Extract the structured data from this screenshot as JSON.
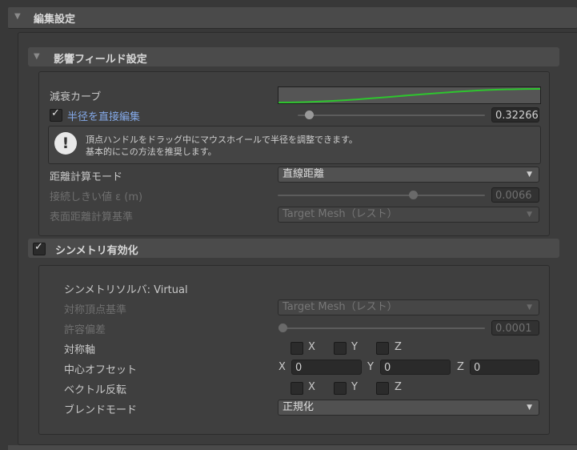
{
  "header": {
    "title": "編集設定"
  },
  "influence": {
    "title": "影響フィールド設定",
    "falloff_curve_label": "減衰カーブ",
    "falloff_curve_color": "#2ec52e",
    "direct_radius_label": "半径を直接編集",
    "direct_radius_checked": true,
    "radius_value": "0.32266",
    "radius_level": 0.04,
    "help_line1": "頂点ハンドルをドラッグ中にマウスホイールで半径を調整できます。",
    "help_line2": "基本的にこの方法を推奨します。",
    "distance_mode_label": "距離計算モード",
    "distance_mode_value": "直線距離",
    "threshold_label": "接続しきい値 ε (m)",
    "threshold_value": "0.0066",
    "threshold_level": 0.66,
    "surface_basis_label": "表面距離計算基準",
    "surface_basis_value": "Target Mesh（レスト）"
  },
  "symmetry": {
    "title": "シンメトリ有効化",
    "enabled": true,
    "solver_label": "シンメトリソルバ: Virtual",
    "vertex_basis_label": "対称頂点基準",
    "vertex_basis_value": "Target Mesh（レスト）",
    "tolerance_label": "許容偏差",
    "tolerance_value": "0.0001",
    "tolerance_level": 0.0,
    "axis_label": "対称軸",
    "center_offset_label": "中心オフセット",
    "offset_x_label": "X",
    "offset_x": "0",
    "offset_y_label": "Y",
    "offset_y": "0",
    "offset_z_label": "Z",
    "offset_z": "0",
    "vector_flip_label": "ベクトル反転",
    "blend_mode_label": "ブレンドモード",
    "blend_mode_value": "正規化",
    "x_label": "X",
    "y_label": "Y",
    "z_label": "Z"
  }
}
